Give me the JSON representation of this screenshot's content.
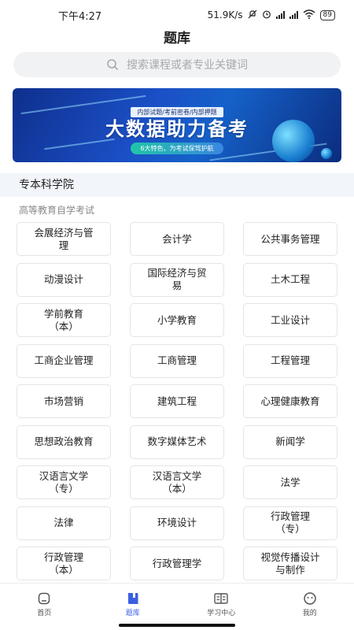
{
  "status_bar": {
    "time": "下午4:27",
    "network_speed": "51.9K/s",
    "battery": "89"
  },
  "header": {
    "title": "题库"
  },
  "search": {
    "placeholder": "搜索课程或者专业关键词",
    "icon": "search-icon"
  },
  "banner": {
    "tag": "内部试题/考前密卷/内部押题",
    "headline": "大数据助力备考",
    "subline": "6大特色，为考试保驾护航"
  },
  "section": {
    "title": "专本科学院",
    "subtitle": "高等教育自学考试"
  },
  "majors": [
    "会展经济与管\n理",
    "会计学",
    "公共事务管理",
    "动漫设计",
    "国际经济与贸\n易",
    "土木工程",
    "学前教育\n（本）",
    "小学教育",
    "工业设计",
    "工商企业管理",
    "工商管理",
    "工程管理",
    "市场营销",
    "建筑工程",
    "心理健康教育",
    "思想政治教育",
    "数字媒体艺术",
    "新闻学",
    "汉语言文学\n（专）",
    "汉语言文学\n（本）",
    "法学",
    "法律",
    "环境设计",
    "行政管理\n（专）",
    "行政管理\n（本）",
    "行政管理学",
    "视觉传播设计\n与制作"
  ],
  "tabbar": {
    "active_color": "#3a5fe0",
    "items": [
      {
        "label": "首页",
        "icon": "home-icon",
        "active": false
      },
      {
        "label": "题库",
        "icon": "question-bank-icon",
        "active": true
      },
      {
        "label": "学习中心",
        "icon": "study-center-icon",
        "active": false
      },
      {
        "label": "我的",
        "icon": "profile-icon",
        "active": false
      }
    ]
  }
}
